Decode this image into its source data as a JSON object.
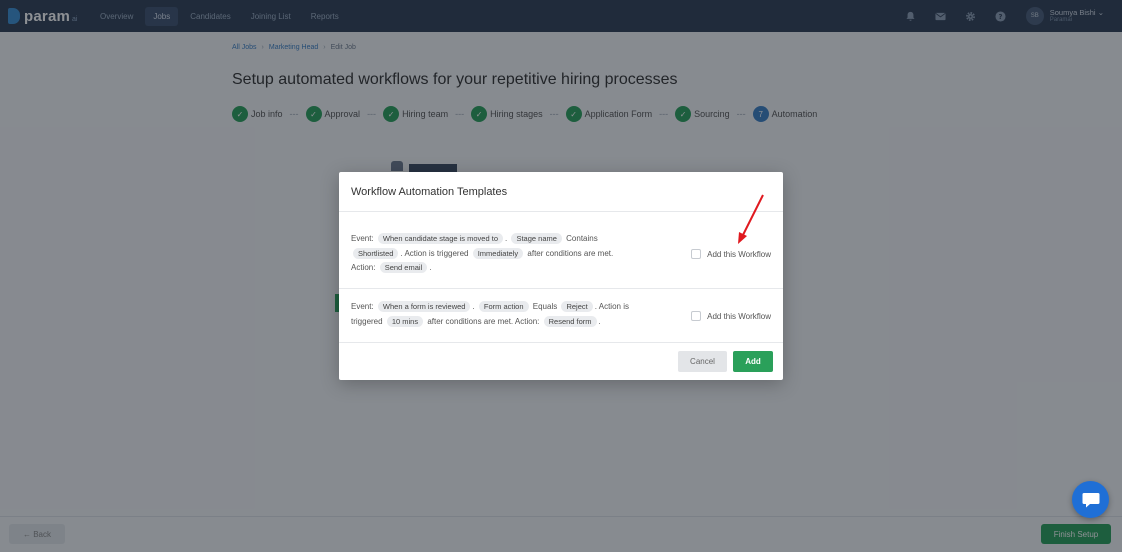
{
  "app": {
    "logo_text": "param",
    "logo_sub": "ai",
    "nav": [
      {
        "label": "Overview",
        "active": false
      },
      {
        "label": "Jobs",
        "active": true
      },
      {
        "label": "Candidates",
        "active": false
      },
      {
        "label": "Joining List",
        "active": false
      },
      {
        "label": "Reports",
        "active": false
      }
    ],
    "icons": [
      "bell-icon",
      "mail-icon",
      "gear-icon",
      "help-icon"
    ],
    "user": {
      "initials": "SB",
      "name": "Soumya Bishi",
      "role": "Paramai"
    }
  },
  "breadcrumb": [
    "All Jobs",
    "Marketing Head",
    "Edit Job"
  ],
  "page_title": "Setup automated workflows for your repetitive hiring processes",
  "steps": [
    {
      "label": "Job info",
      "status": "done"
    },
    {
      "label": "Approval",
      "status": "done"
    },
    {
      "label": "Hiring team",
      "status": "done"
    },
    {
      "label": "Hiring stages",
      "status": "done"
    },
    {
      "label": "Application Form",
      "status": "done"
    },
    {
      "label": "Sourcing",
      "status": "done"
    },
    {
      "label": "Automation",
      "status": "current",
      "number": "7"
    }
  ],
  "step_separator": "---",
  "modal": {
    "title": "Workflow Automation Templates",
    "workflow1": {
      "event_label": "Event:",
      "event_chip": "When candidate stage is moved to",
      "dot": ".",
      "field_chip": "Stage name",
      "operator": "Contains",
      "value_chip": "Shortlisted",
      "trigger_text": ". Action is triggered",
      "timing_chip": "Immediately",
      "after_text": "after conditions are met.",
      "action_label": "Action:",
      "action_chip": "Send email",
      "end": ".",
      "checkbox_label": "Add this Workflow",
      "checked": false
    },
    "workflow2": {
      "event_label": "Event:",
      "event_chip": "When a form is reviewed",
      "dot": ".",
      "field_chip": "Form action",
      "operator": "Equals",
      "value_chip": "Reject",
      "trigger_text": ". Action is triggered",
      "timing_chip": "10 mins",
      "after_text": "after conditions are met. Action:",
      "action_chip": "Resend form",
      "end": ".",
      "checkbox_label": "Add this Workflow",
      "checked": false
    },
    "cancel_label": "Cancel",
    "add_label": "Add"
  },
  "footer": {
    "back_label": "Back",
    "finish_label": "Finish Setup"
  },
  "colors": {
    "primary_green": "#2aa05a",
    "nav_bg": "#2e3e55",
    "accent_blue": "#3b7fc4",
    "annotation_red": "#e0191f"
  }
}
